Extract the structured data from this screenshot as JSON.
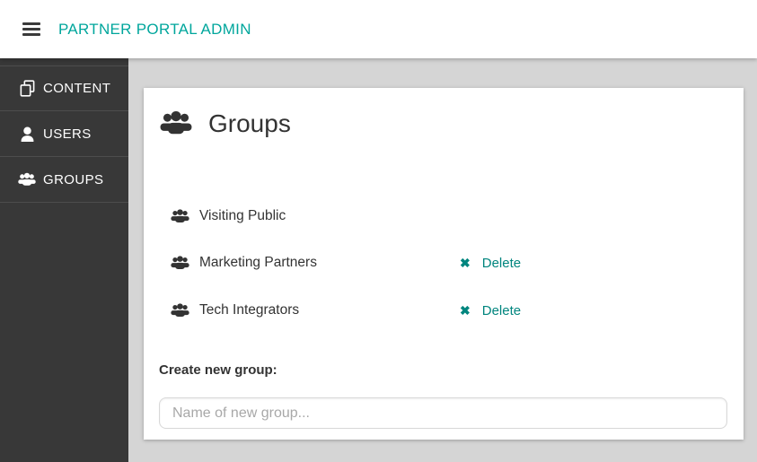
{
  "topbar": {
    "title": "PARTNER PORTAL ADMIN"
  },
  "sidebar": {
    "items": [
      {
        "label": "CONTENT",
        "icon": "content-copy-icon"
      },
      {
        "label": "USERS",
        "icon": "user-icon"
      },
      {
        "label": "GROUPS",
        "icon": "users-icon"
      }
    ]
  },
  "main": {
    "heading": "Groups",
    "heading_icon": "users-icon",
    "groups": [
      {
        "name": "Visiting Public"
      },
      {
        "name": "Marketing Partners",
        "delete_label": "Delete"
      },
      {
        "name": "Tech Integrators",
        "delete_label": "Delete"
      }
    ],
    "delete_icon": "✖",
    "create_label": "Create new group:",
    "input_placeholder": "Name of new group...",
    "input_value": ""
  },
  "colors": {
    "accent_title_teal": "#00A69C",
    "delete_link_teal": "#00857E",
    "sidebar_bg": "#383838",
    "content_bg": "#D5D5D5",
    "card_bg": "#FFFFFF",
    "text_dark": "#333333"
  }
}
